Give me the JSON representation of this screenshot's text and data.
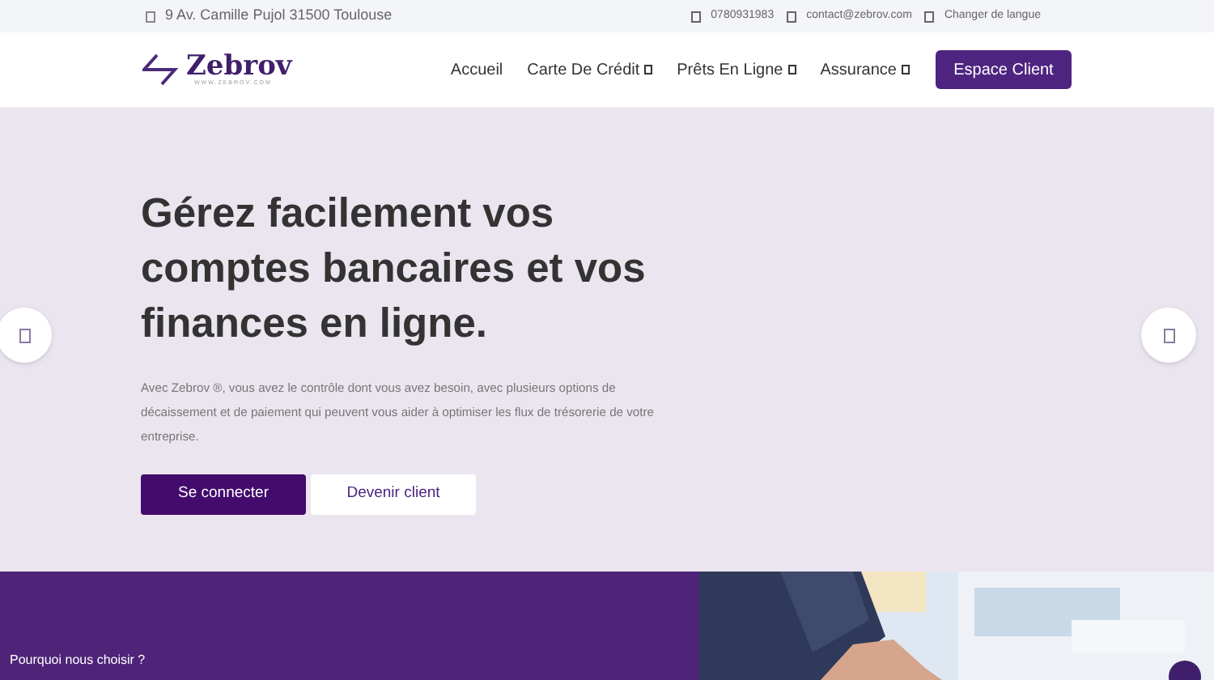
{
  "top_bar": {
    "address": "9 Av. Camille Pujol 31500 Toulouse",
    "phone": "0780931983",
    "email": "contact@zebrov.com",
    "language": "Changer de langue"
  },
  "header": {
    "logo": "Zebrov",
    "logo_tagline": "WWW.ZEBROV.COM",
    "nav": [
      {
        "label": "Accueil",
        "dropdown": false
      },
      {
        "label": "Carte De Crédit",
        "dropdown": true
      },
      {
        "label": "Prêts En Ligne",
        "dropdown": true
      },
      {
        "label": "Assurance",
        "dropdown": true
      }
    ],
    "cta": "Espace Client"
  },
  "hero": {
    "title": "Gérez facilement vos comptes bancaires et vos finances en ligne.",
    "text": "Avec Zebrov ®, vous avez le contrôle dont vous avez besoin, avec plusieurs options de décaissement et de paiement qui peuvent vous aider à optimiser les flux de trésorerie de votre entreprise.",
    "buttons": [
      {
        "label": "Se connecter",
        "kind": "primary"
      },
      {
        "label": "Devenir client",
        "kind": "secondary"
      }
    ]
  },
  "why": {
    "label": "Pourquoi nous choisir ?"
  }
}
